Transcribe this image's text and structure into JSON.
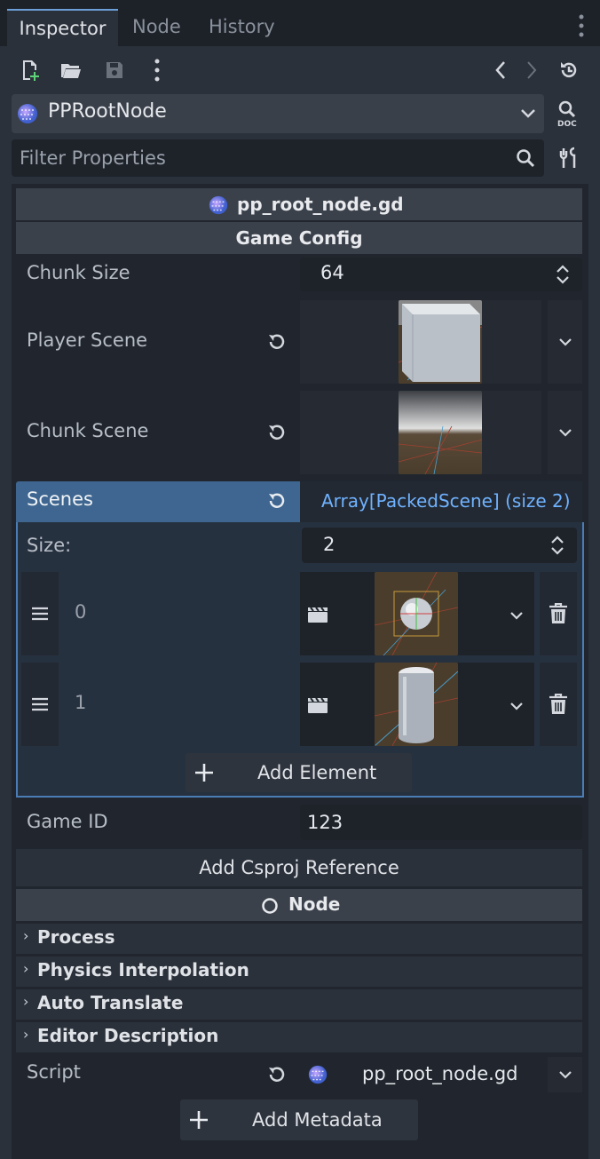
{
  "tabs": [
    "Inspector",
    "Node",
    "History"
  ],
  "object_selector": {
    "name": "PPRootNode"
  },
  "filter": {
    "placeholder": "Filter Properties"
  },
  "script_section": {
    "title": "pp_root_node.gd",
    "group": "Game Config"
  },
  "chunk_size": {
    "label": "Chunk Size",
    "value": "64"
  },
  "player_scene": {
    "label": "Player Scene"
  },
  "chunk_scene": {
    "label": "Chunk Scene"
  },
  "scenes": {
    "label": "Scenes",
    "type": "Array[PackedScene] (size 2)",
    "size_label": "Size:",
    "size_value": "2",
    "items": [
      {
        "index": "0"
      },
      {
        "index": "1"
      }
    ],
    "add_label": "Add Element"
  },
  "game_id": {
    "label": "Game ID",
    "value": "123"
  },
  "add_csproj": "Add Csproj Reference",
  "node_section": {
    "title": "Node"
  },
  "groups": [
    "Process",
    "Physics Interpolation",
    "Auto Translate",
    "Editor Description"
  ],
  "script": {
    "label": "Script",
    "value": "pp_root_node.gd"
  },
  "add_metadata": "Add Metadata",
  "colors": {
    "accent": "#6a9fd8",
    "array_header": "#3e6690",
    "array_border": "#4a7db5",
    "background": "#21262e"
  }
}
